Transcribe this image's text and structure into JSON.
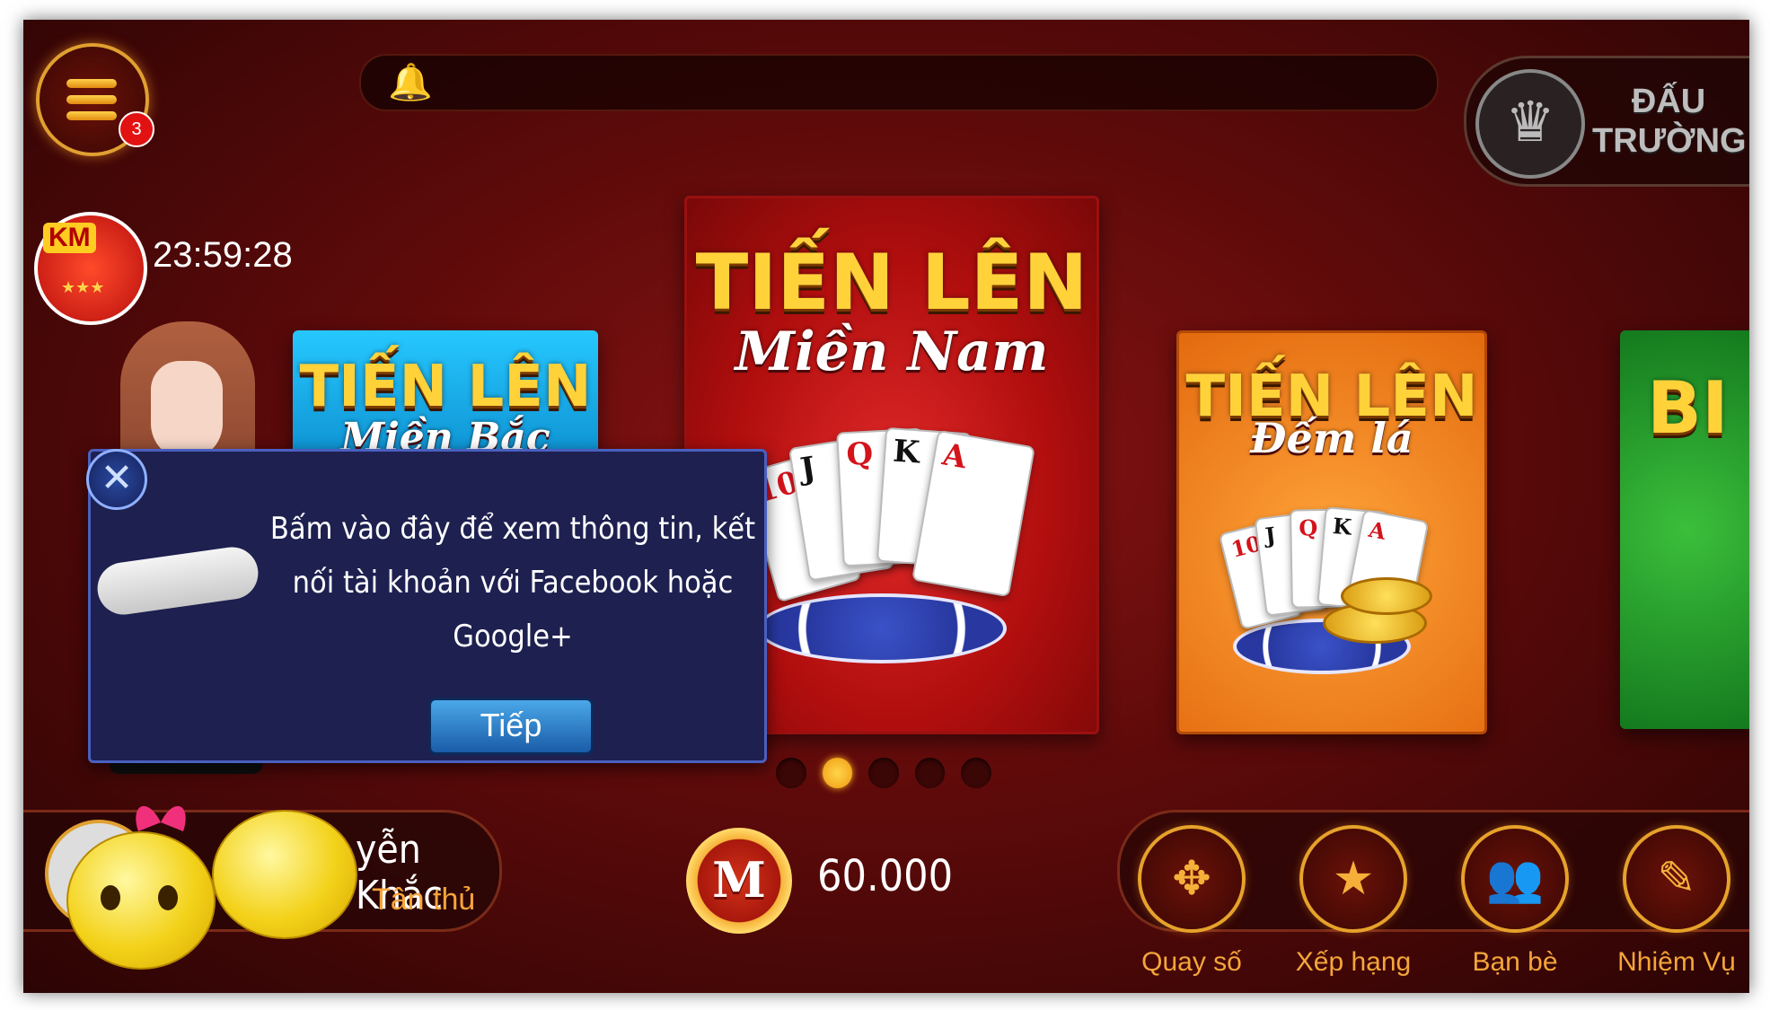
{
  "top": {
    "menu_badge": "3",
    "arena_label_line1": "ĐẤU",
    "arena_label_line2": "TRƯỜNG"
  },
  "promo": {
    "tag": "KM",
    "timer": "23:59:28"
  },
  "games": [
    {
      "title": "TIẾN LÊN",
      "subtitle": "Miền Bắc"
    },
    {
      "title": "TIẾN LÊN",
      "subtitle": "Miền Nam"
    },
    {
      "title": "TIẾN LÊN",
      "subtitle": "Đếm lá"
    },
    {
      "title": "BI"
    }
  ],
  "card_ranks": [
    "10",
    "J",
    "Q",
    "K",
    "A"
  ],
  "carousel": {
    "count": 5,
    "active_index": 1
  },
  "tooltip": {
    "message": "Bấm vào đây để xem thông tin, kết nối tài khoản với Facebook hoặc Google+",
    "button_label": "Tiếp"
  },
  "profile": {
    "name": "yễn Khắc",
    "rank": "Tân thủ"
  },
  "currency": {
    "symbol": "M",
    "amount": "60.000"
  },
  "nav": [
    {
      "label": "Quay số",
      "icon": "roulette-icon"
    },
    {
      "label": "Xếp hạng",
      "icon": "star-laurel-icon"
    },
    {
      "label": "Bạn bè",
      "icon": "friends-icon"
    },
    {
      "label": "Nhiệm Vụ",
      "icon": "clipboard-icon"
    }
  ],
  "colors": {
    "accent_gold": "#f6a43a",
    "background_red": "#8a1414",
    "tooltip_bg": "#1e2050"
  }
}
